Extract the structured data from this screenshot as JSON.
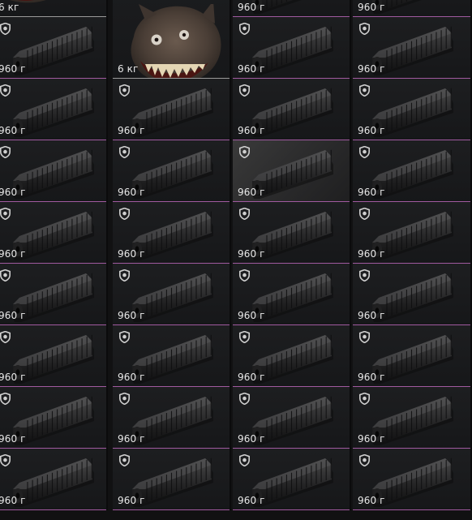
{
  "inventory": {
    "columns": 4,
    "rows": 9,
    "colors": {
      "rarity_line": "#a05aa0",
      "mask_line": "#9a9a9a",
      "text": "#e8e8e8",
      "background": "#111112"
    },
    "rows_data": [
      [
        {
          "weight": "6 кг",
          "icon": "wolf-mask-icon",
          "shield": false
        },
        {
          "weight": "6 кг",
          "icon": "wolf-mask-icon",
          "shield": false,
          "span_rows": 2
        },
        {
          "weight": "960 г",
          "icon": "suppressor-icon",
          "shield": false
        },
        {
          "weight": "960 г",
          "icon": "suppressor-icon",
          "shield": false
        }
      ],
      [
        {
          "weight": "960 г",
          "icon": "suppressor-icon",
          "shield": true
        },
        null,
        {
          "weight": "960 г",
          "icon": "suppressor-icon",
          "shield": true
        },
        {
          "weight": "960 г",
          "icon": "suppressor-icon",
          "shield": true
        }
      ],
      [
        {
          "weight": "960 г",
          "icon": "suppressor-icon",
          "shield": true
        },
        {
          "weight": "960 г",
          "icon": "suppressor-icon",
          "shield": true
        },
        {
          "weight": "960 г",
          "icon": "suppressor-icon",
          "shield": true
        },
        {
          "weight": "960 г",
          "icon": "suppressor-icon",
          "shield": true
        }
      ],
      [
        {
          "weight": "960 г",
          "icon": "suppressor-icon",
          "shield": true
        },
        {
          "weight": "960 г",
          "icon": "suppressor-icon",
          "shield": true
        },
        {
          "weight": "960 г",
          "icon": "suppressor-icon",
          "shield": true,
          "hovered": true
        },
        {
          "weight": "960 г",
          "icon": "suppressor-icon",
          "shield": true
        }
      ],
      [
        {
          "weight": "960 г",
          "icon": "suppressor-icon",
          "shield": true
        },
        {
          "weight": "960 г",
          "icon": "suppressor-icon",
          "shield": true
        },
        {
          "weight": "960 г",
          "icon": "suppressor-icon",
          "shield": true
        },
        {
          "weight": "960 г",
          "icon": "suppressor-icon",
          "shield": true
        }
      ],
      [
        {
          "weight": "960 г",
          "icon": "suppressor-icon",
          "shield": true
        },
        {
          "weight": "960 г",
          "icon": "suppressor-icon",
          "shield": true
        },
        {
          "weight": "960 г",
          "icon": "suppressor-icon",
          "shield": true
        },
        {
          "weight": "960 г",
          "icon": "suppressor-icon",
          "shield": true
        }
      ],
      [
        {
          "weight": "960 г",
          "icon": "suppressor-icon",
          "shield": true
        },
        {
          "weight": "960 г",
          "icon": "suppressor-icon",
          "shield": true
        },
        {
          "weight": "960 г",
          "icon": "suppressor-icon",
          "shield": true
        },
        {
          "weight": "960 г",
          "icon": "suppressor-icon",
          "shield": true
        }
      ],
      [
        {
          "weight": "960 г",
          "icon": "suppressor-icon",
          "shield": true
        },
        {
          "weight": "960 г",
          "icon": "suppressor-icon",
          "shield": true
        },
        {
          "weight": "960 г",
          "icon": "suppressor-icon",
          "shield": true
        },
        {
          "weight": "960 г",
          "icon": "suppressor-icon",
          "shield": true
        }
      ],
      [
        {
          "weight": "960 г",
          "icon": "suppressor-icon",
          "shield": true
        },
        {
          "weight": "960 г",
          "icon": "suppressor-icon",
          "shield": true
        },
        {
          "weight": "960 г",
          "icon": "suppressor-icon",
          "shield": true
        },
        {
          "weight": "960 г",
          "icon": "suppressor-icon",
          "shield": true
        }
      ]
    ]
  }
}
